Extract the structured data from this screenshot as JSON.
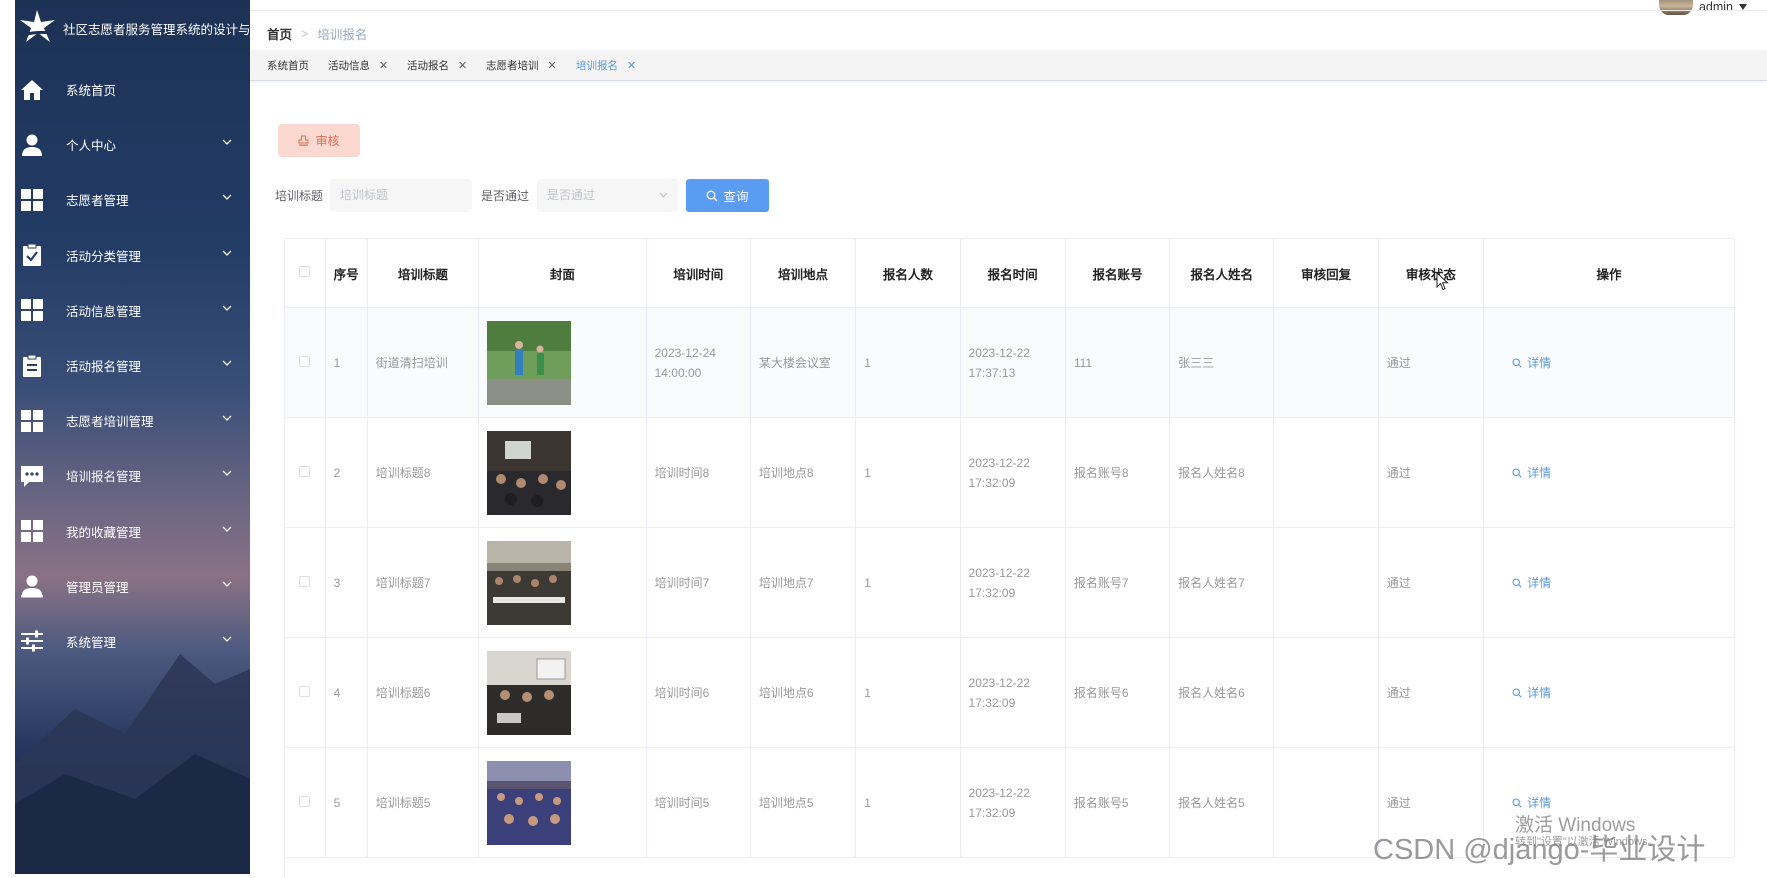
{
  "app": {
    "title": "社区志愿者服务管理系统的设计与实现",
    "user": "admin"
  },
  "sidebar": {
    "items": [
      {
        "label": "系统首页",
        "icon": "home-icon"
      },
      {
        "label": "个人中心",
        "icon": "user-icon"
      },
      {
        "label": "志愿者管理",
        "icon": "grid-icon"
      },
      {
        "label": "活动分类管理",
        "icon": "clipboard-check-icon"
      },
      {
        "label": "活动信息管理",
        "icon": "grid-icon"
      },
      {
        "label": "活动报名管理",
        "icon": "clipboard-icon"
      },
      {
        "label": "志愿者培训管理",
        "icon": "grid-icon"
      },
      {
        "label": "培训报名管理",
        "icon": "chat-icon"
      },
      {
        "label": "我的收藏管理",
        "icon": "grid-icon"
      },
      {
        "label": "管理员管理",
        "icon": "admin-icon"
      },
      {
        "label": "系统管理",
        "icon": "sliders-icon"
      }
    ]
  },
  "breadcrumb": {
    "home": "首页",
    "separator": ">",
    "current": "培训报名"
  },
  "tags": [
    {
      "label": "系统首页",
      "closable": false,
      "active": false
    },
    {
      "label": "活动信息",
      "closable": true,
      "active": false
    },
    {
      "label": "活动报名",
      "closable": true,
      "active": false
    },
    {
      "label": "志愿者培训",
      "closable": true,
      "active": false
    },
    {
      "label": "培训报名",
      "closable": true,
      "active": true
    }
  ],
  "toolbar": {
    "audit_label": "审核"
  },
  "search": {
    "title_label": "培训标题",
    "title_placeholder": "培训标题",
    "pass_label": "是否通过",
    "pass_placeholder": "是否通过",
    "query_label": "查询"
  },
  "table": {
    "columns": [
      "序号",
      "培训标题",
      "封面",
      "培训时间",
      "培训地点",
      "报名人数",
      "报名时间",
      "报名账号",
      "报名人姓名",
      "审核回复",
      "审核状态",
      "操作"
    ],
    "rows": [
      {
        "index": "1",
        "title": "街道清扫培训",
        "time": "2023-12-24 14:00:00",
        "place": "某大楼会议室",
        "count": "1",
        "signup_time": "2023-12-22 17:37:13",
        "account": "111",
        "name": "张三三",
        "reply": "",
        "status": "通过",
        "action": "详情"
      },
      {
        "index": "2",
        "title": "培训标题8",
        "time": "培训时间8",
        "place": "培训地点8",
        "count": "1",
        "signup_time": "2023-12-22 17:32:09",
        "account": "报名账号8",
        "name": "报名人姓名8",
        "reply": "",
        "status": "通过",
        "action": "详情"
      },
      {
        "index": "3",
        "title": "培训标题7",
        "time": "培训时间7",
        "place": "培训地点7",
        "count": "1",
        "signup_time": "2023-12-22 17:32:09",
        "account": "报名账号7",
        "name": "报名人姓名7",
        "reply": "",
        "status": "通过",
        "action": "详情"
      },
      {
        "index": "4",
        "title": "培训标题6",
        "time": "培训时间6",
        "place": "培训地点6",
        "count": "1",
        "signup_time": "2023-12-22 17:32:09",
        "account": "报名账号6",
        "name": "报名人姓名6",
        "reply": "",
        "status": "通过",
        "action": "详情"
      },
      {
        "index": "5",
        "title": "培训标题5",
        "time": "培训时间5",
        "place": "培训地点5",
        "count": "1",
        "signup_time": "2023-12-22 17:32:09",
        "account": "报名账号5",
        "name": "报名人姓名5",
        "reply": "",
        "status": "通过",
        "action": "详情"
      }
    ]
  },
  "watermarks": {
    "activate": "激活 Windows",
    "activate_sub": "转到\"设置\"以激活 Windows。",
    "csdn": "CSDN @django-毕业设计"
  },
  "colors": {
    "accent": "#5b9cf3",
    "audit_bg": "#fbd9d0",
    "audit_text": "#e26b50",
    "tag_active": "#5b9bd5"
  }
}
